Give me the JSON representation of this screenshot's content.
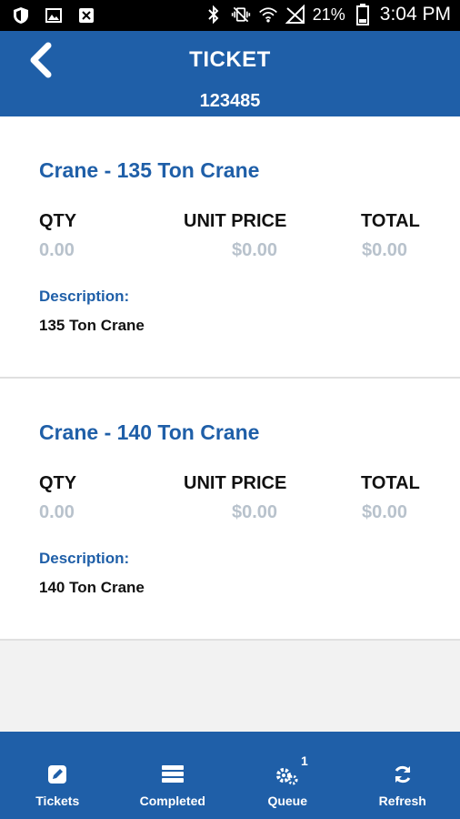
{
  "status_bar": {
    "battery": "21%",
    "time": "3:04 PM",
    "left_icons": [
      "shield-icon",
      "image-icon",
      "close-box-icon"
    ],
    "right_icons": [
      "bluetooth-icon",
      "vibrate-icon",
      "wifi-icon",
      "signal-icon",
      "battery-icon"
    ]
  },
  "header": {
    "title": "TICKET",
    "ticket_number": "123485"
  },
  "items": [
    {
      "title": "Crane - 135 Ton Crane",
      "qty_label": "QTY",
      "unit_price_label": "UNIT PRICE",
      "total_label": "TOTAL",
      "qty": "0.00",
      "unit_price": "$0.00",
      "total": "$0.00",
      "description_label": "Description:",
      "description": "135 Ton Crane"
    },
    {
      "title": "Crane - 140 Ton Crane",
      "qty_label": "QTY",
      "unit_price_label": "UNIT PRICE",
      "total_label": "TOTAL",
      "qty": "0.00",
      "unit_price": "$0.00",
      "total": "$0.00",
      "description_label": "Description:",
      "description": "140 Ton Crane"
    }
  ],
  "bottom_nav": {
    "items": [
      {
        "label": "Tickets",
        "icon": "edit-icon"
      },
      {
        "label": "Completed",
        "icon": "stack-icon"
      },
      {
        "label": "Queue",
        "icon": "gears-icon",
        "badge": "1"
      },
      {
        "label": "Refresh",
        "icon": "refresh-icon"
      }
    ]
  },
  "colors": {
    "brand": "#1f5fa8",
    "muted_value": "#b8c2cc"
  }
}
